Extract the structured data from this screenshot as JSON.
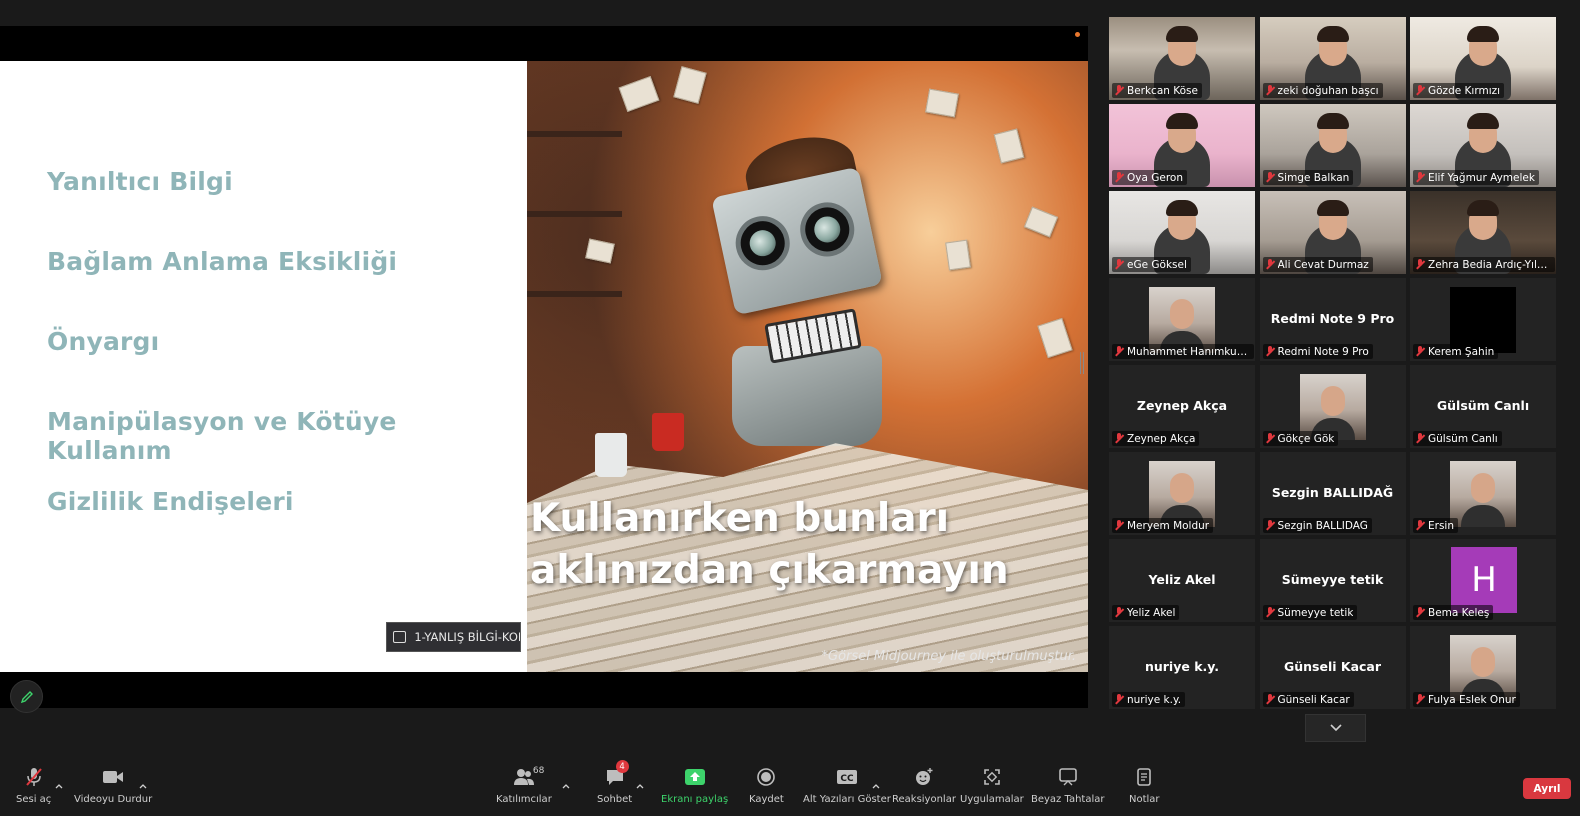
{
  "slide": {
    "items": [
      "Yanıltıcı Bilgi",
      "Bağlam Anlama Eksikliği",
      "Önyargı",
      "Manipülasyon ve Kötüye Kullanım",
      "Gizlilik Endişeleri"
    ],
    "caption": "Kullanırken bunları\naklınızdan çıkarmayın",
    "credit": "*Görsel Midjourney ile oluşturulmuştur.",
    "comment_tag": "1-YANLIŞ BİLGİ-KON"
  },
  "gallery": {
    "tiles": [
      {
        "name": "Berkcan Köse",
        "kind": "video"
      },
      {
        "name": "zeki doğuhan başcı",
        "kind": "video"
      },
      {
        "name": "Gözde Kırmızı",
        "kind": "video"
      },
      {
        "name": "Oya Geron",
        "kind": "video",
        "active": true
      },
      {
        "name": "Simge Balkan",
        "kind": "video"
      },
      {
        "name": "Elif Yağmur Aymelek",
        "kind": "video"
      },
      {
        "name": "eGe Göksel",
        "kind": "video"
      },
      {
        "name": "Ali Cevat Durmaz",
        "kind": "video"
      },
      {
        "name": "Zehra Bedia Ardıç-Yılmaz",
        "kind": "video"
      },
      {
        "name": "Muhammet Hanımkulov",
        "kind": "photo"
      },
      {
        "name": "Redmi Note 9 Pro",
        "kind": "text",
        "display": "Redmi Note 9 Pro"
      },
      {
        "name": "Kerem Şahin",
        "kind": "photo-black"
      },
      {
        "name": "Zeynep Akça",
        "kind": "text",
        "display": "Zeynep Akça"
      },
      {
        "name": "Gökçe Gök",
        "kind": "photo"
      },
      {
        "name": "Gülsüm Canlı",
        "kind": "text",
        "display": "Gülsüm Canlı"
      },
      {
        "name": "Meryem Moldur",
        "kind": "photo"
      },
      {
        "name": "Sezgin BALLIDAĞ",
        "kind": "text",
        "display": "Sezgin BALLIDAĞ"
      },
      {
        "name": "Ersin",
        "kind": "photo"
      },
      {
        "name": "Yeliz Akel",
        "kind": "text",
        "display": "Yeliz Akel"
      },
      {
        "name": "Sümeyye tetik",
        "kind": "text",
        "display": "Sümeyye tetik"
      },
      {
        "name": "Bema Keleş",
        "kind": "letter",
        "display": "H"
      },
      {
        "name": "nuriye k.y.",
        "kind": "text",
        "display": "nuriye k.y."
      },
      {
        "name": "Günseli Kacar",
        "kind": "text",
        "display": "Günseli Kacar"
      },
      {
        "name": "Fulya Eslek Onur",
        "kind": "photo"
      }
    ]
  },
  "toolbar": {
    "unmute_label": "Sesi aç",
    "stop_video_label": "Videoyu Durdur",
    "participants_label": "Katılımcılar",
    "participants_count": "68",
    "chat_label": "Sohbet",
    "chat_badge": "4",
    "share_label": "Ekranı paylaş",
    "record_label": "Kaydet",
    "captions_label": "Alt Yazıları Göster",
    "reactions_label": "Reaksiyonlar",
    "apps_label": "Uygulamalar",
    "whiteboard_label": "Beyaz Tahtalar",
    "notes_label": "Notlar",
    "leave_label": "Ayrıl"
  },
  "colors": {
    "accent_active_tile": "#d9e76b",
    "share_green": "#3dd36b",
    "leave_red": "#d9383f",
    "slide_text": "#8fb5b8"
  }
}
